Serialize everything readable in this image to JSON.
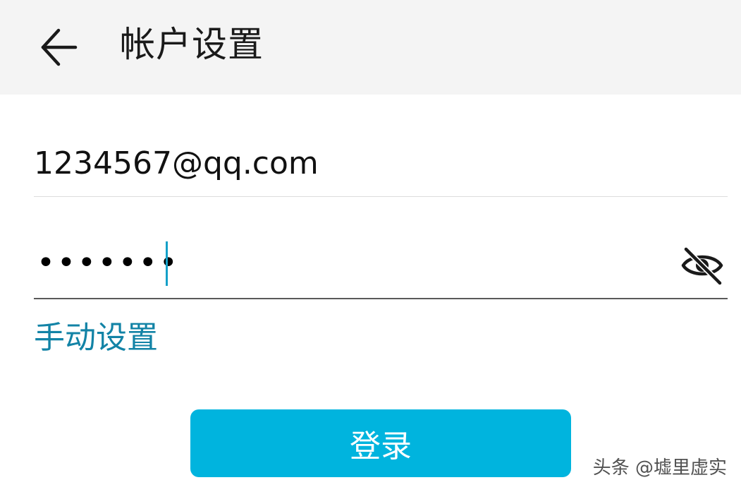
{
  "header": {
    "back_icon": "arrow-left-icon",
    "title": "帐户设置"
  },
  "form": {
    "email_value": "1234567@qq.com",
    "password_masked": "•••••••",
    "visibility_icon": "eye-off-icon",
    "manual_setup_label": "手动设置",
    "login_label": "登录"
  },
  "watermark": "头条 @墟里虚实",
  "colors": {
    "header_bg": "#f4f4f4",
    "accent": "#00b4de",
    "link": "#1283a6",
    "caret": "#14a0c8"
  }
}
